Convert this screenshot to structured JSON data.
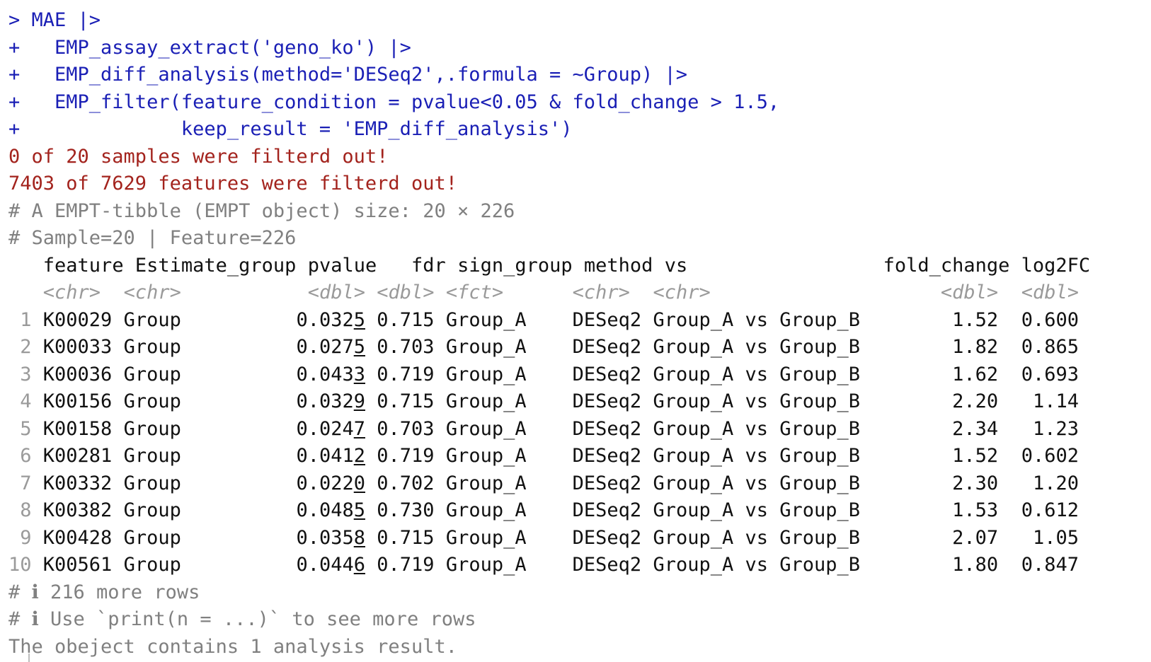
{
  "commands": [
    "> MAE |>",
    "+   EMP_assay_extract('geno_ko') |>",
    "+   EMP_diff_analysis(method='DESeq2',.formula = ~Group) |>",
    "+   EMP_filter(feature_condition = pvalue<0.05 & fold_change > 1.5,",
    "+              keep_result = 'EMP_diff_analysis')"
  ],
  "messages": [
    "0 of 20 samples were filterd out!",
    "7403 of 7629 features were filterd out!"
  ],
  "tibble_header": [
    "# A EMPT-tibble (EMPT object) size: 20 × 226",
    "# Sample=20 | Feature=226"
  ],
  "columns": [
    "feature",
    "Estimate_group",
    "pvalue",
    "fdr",
    "sign_group",
    "method",
    "vs",
    "fold_change",
    "log2FC"
  ],
  "types": [
    "<chr>",
    "<chr>",
    "<dbl>",
    "<dbl>",
    "<fct>",
    "<chr>",
    "<chr>",
    "<dbl>",
    "<dbl>"
  ],
  "rows": [
    {
      "n": "1",
      "feature": "K00029",
      "group": "Group",
      "pvalue": "0.0325",
      "fdr": "0.715",
      "sign": "Group_A",
      "method": "DESeq2",
      "vs": "Group_A vs Group_B",
      "fc": "1.52",
      "log2fc": "0.600"
    },
    {
      "n": "2",
      "feature": "K00033",
      "group": "Group",
      "pvalue": "0.0275",
      "fdr": "0.703",
      "sign": "Group_A",
      "method": "DESeq2",
      "vs": "Group_A vs Group_B",
      "fc": "1.82",
      "log2fc": "0.865"
    },
    {
      "n": "3",
      "feature": "K00036",
      "group": "Group",
      "pvalue": "0.0433",
      "fdr": "0.719",
      "sign": "Group_A",
      "method": "DESeq2",
      "vs": "Group_A vs Group_B",
      "fc": "1.62",
      "log2fc": "0.693"
    },
    {
      "n": "4",
      "feature": "K00156",
      "group": "Group",
      "pvalue": "0.0329",
      "fdr": "0.715",
      "sign": "Group_A",
      "method": "DESeq2",
      "vs": "Group_A vs Group_B",
      "fc": "2.20",
      "log2fc": "1.14"
    },
    {
      "n": "5",
      "feature": "K00158",
      "group": "Group",
      "pvalue": "0.0247",
      "fdr": "0.703",
      "sign": "Group_A",
      "method": "DESeq2",
      "vs": "Group_A vs Group_B",
      "fc": "2.34",
      "log2fc": "1.23"
    },
    {
      "n": "6",
      "feature": "K00281",
      "group": "Group",
      "pvalue": "0.0412",
      "fdr": "0.719",
      "sign": "Group_A",
      "method": "DESeq2",
      "vs": "Group_A vs Group_B",
      "fc": "1.52",
      "log2fc": "0.602"
    },
    {
      "n": "7",
      "feature": "K00332",
      "group": "Group",
      "pvalue": "0.0220",
      "fdr": "0.702",
      "sign": "Group_A",
      "method": "DESeq2",
      "vs": "Group_A vs Group_B",
      "fc": "2.30",
      "log2fc": "1.20"
    },
    {
      "n": "8",
      "feature": "K00382",
      "group": "Group",
      "pvalue": "0.0485",
      "fdr": "0.730",
      "sign": "Group_A",
      "method": "DESeq2",
      "vs": "Group_A vs Group_B",
      "fc": "1.53",
      "log2fc": "0.612"
    },
    {
      "n": "9",
      "feature": "K00428",
      "group": "Group",
      "pvalue": "0.0358",
      "fdr": "0.715",
      "sign": "Group_A",
      "method": "DESeq2",
      "vs": "Group_A vs Group_B",
      "fc": "2.07",
      "log2fc": "1.05"
    },
    {
      "n": "10",
      "feature": "K00561",
      "group": "Group",
      "pvalue": "0.0446",
      "fdr": "0.719",
      "sign": "Group_A",
      "method": "DESeq2",
      "vs": "Group_A vs Group_B",
      "fc": "1.80",
      "log2fc": "0.847"
    }
  ],
  "footer": [
    "# ℹ 216 more rows",
    "# ℹ Use `print(n = ...)` to see more rows"
  ],
  "result_note": "The obeject contains 1 analysis result.",
  "colors": {
    "command": "#1a1fb5",
    "error": "#a3231d",
    "comment": "#808080",
    "text": "#111111"
  }
}
